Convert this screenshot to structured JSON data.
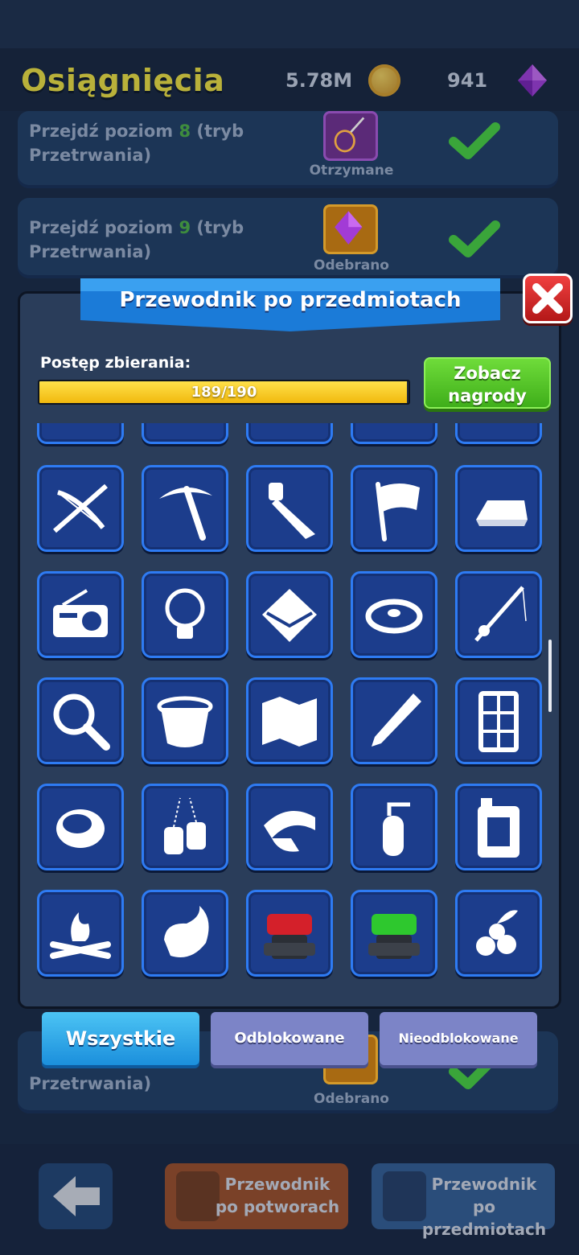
{
  "header": {
    "title": "Osiągnięcia",
    "coins": "5.78M",
    "gems": "941"
  },
  "achievements": [
    {
      "text_prefix": "Przejdź poziom ",
      "level": "8",
      "text_suffix": " (tryb Przetrwania)",
      "status": "Otrzymane",
      "reward_icon": "net-icon"
    },
    {
      "text_prefix": "Przejdź poziom ",
      "level": "9",
      "text_suffix": " (tryb Przetrwania)",
      "status": "Odebrano",
      "reward_icon": "gem-icon"
    },
    {
      "text_line2": "Przetrwania)",
      "status": "Odebrano",
      "reward_icon": "gem-icon"
    }
  ],
  "modal": {
    "title": "Przewodnik po przedmiotach",
    "progress_label": "Postęp zbierania:",
    "progress_text": "189/190",
    "progress_fraction": 0.995,
    "rewards_button_line1": "Zobacz",
    "rewards_button_line2": "nagrody"
  },
  "items": [
    "crossbow-icon",
    "pickaxe-icon",
    "saw-icon",
    "flag-icon",
    "gold-bar-icon",
    "radio-icon",
    "light-bulb-icon",
    "envelope-icon",
    "bear-trap-icon",
    "fishing-rod-icon",
    "magnifying-glass-icon",
    "bucket-icon",
    "map-icon",
    "pen-icon",
    "window-icon",
    "button-icon",
    "dog-tags-icon",
    "tape-roll-icon",
    "fire-extinguisher-icon",
    "jerrycan-icon",
    "campfire-icon",
    "meat-icon",
    "red-turret-icon",
    "green-turret-icon",
    "berries-icon"
  ],
  "filters": {
    "all": "Wszystkie",
    "unlocked": "Odblokowane",
    "locked": "Nieodblokowane"
  },
  "nav": {
    "monsters_line1": "Przewodnik",
    "monsters_line2": "po potworach",
    "items_line1": "Przewodnik po",
    "items_line2": "przedmiotach"
  },
  "colors": {
    "accent_blue": "#2e7bf3",
    "progress_yellow": "#f1b90e",
    "rewards_green": "#4fc42a",
    "close_red": "#d42020"
  }
}
